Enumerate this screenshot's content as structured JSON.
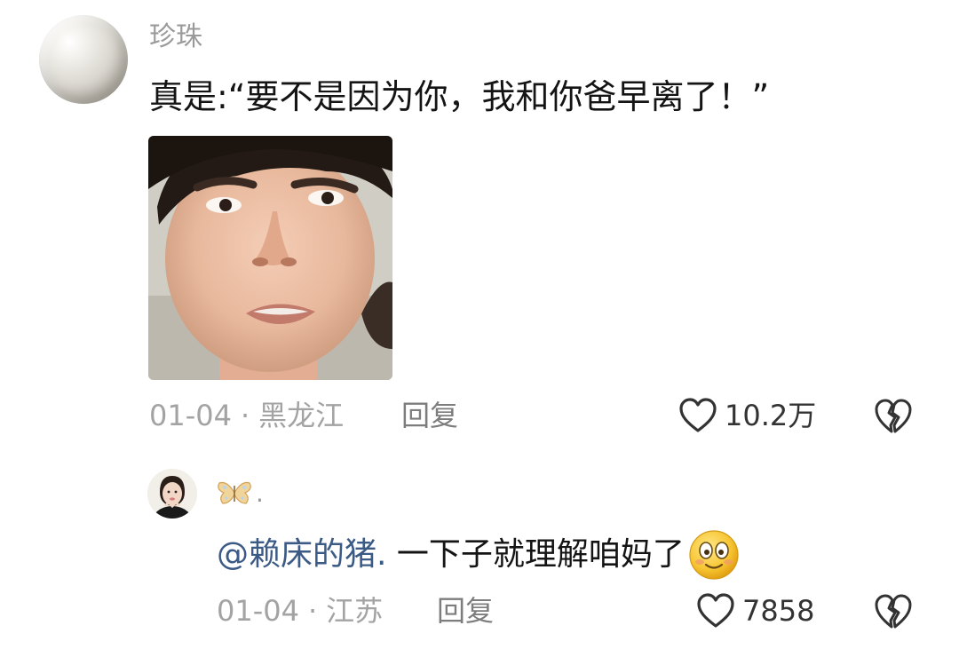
{
  "comment": {
    "username": "珍珠",
    "text": "真是:“要不是因为你，我和你爸早离了！”",
    "date": "01-04",
    "separator": "·",
    "location": "黑龙江",
    "reply_label": "回复",
    "like_count": "10.2万"
  },
  "reply": {
    "username_suffix": ".",
    "mention": "@赖床的猪.",
    "text": " 一下子就理解咱妈了",
    "date": "01-04",
    "separator": "·",
    "location": "江苏",
    "reply_label": "回复",
    "like_count": "7858"
  },
  "icons": {
    "heart": "heart-outline-icon",
    "dislike": "broken-heart-icon",
    "emoji": "smiling-face-emoji",
    "butterfly": "butterfly-icon",
    "avatar_main": "pearl-avatar"
  },
  "colors": {
    "text_primary": "#141414",
    "text_secondary": "#9a9a9a",
    "mention": "#3b5a86"
  }
}
